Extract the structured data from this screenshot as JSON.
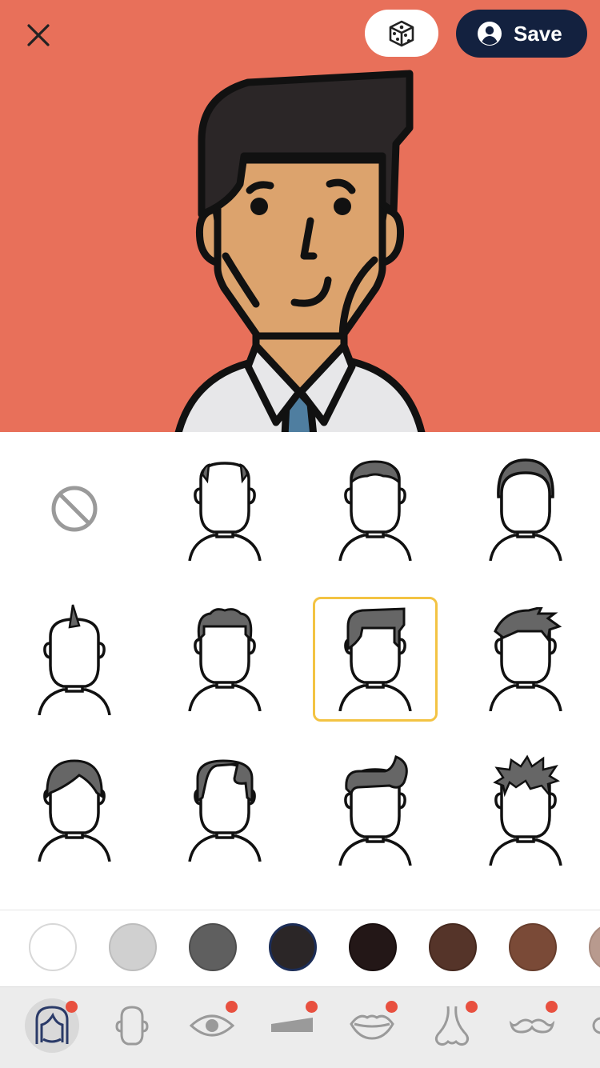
{
  "header": {
    "close_icon": "close-icon",
    "randomize_icon": "dice-icon",
    "save_label": "Save",
    "save_icon": "user-circle-icon"
  },
  "preview": {
    "background_color": "#e8705a",
    "hair_color": "#2b2627",
    "skin_color": "#dca36d",
    "shirt_color": "#e7e7e9",
    "tie_color": "#4f7ea0"
  },
  "hair_styles": {
    "selected_index": 6,
    "selection_color": "#f3c343",
    "items": [
      {
        "icon": "none-icon"
      },
      {
        "icon": "hair-bald-icon"
      },
      {
        "icon": "hair-buzz-icon"
      },
      {
        "icon": "hair-round-icon"
      },
      {
        "icon": "hair-mohawk-icon"
      },
      {
        "icon": "hair-curly-icon"
      },
      {
        "icon": "hair-side-part-icon"
      },
      {
        "icon": "hair-spiky-side-icon"
      },
      {
        "icon": "hair-bowl-icon"
      },
      {
        "icon": "hair-slick-icon"
      },
      {
        "icon": "hair-quiff-icon"
      },
      {
        "icon": "hair-messy-icon"
      }
    ]
  },
  "hair_colors": {
    "selected_index": 3,
    "swatches": [
      "#ffffff",
      "#d0d0d0",
      "#5f5f5f",
      "#2b2627",
      "#231717",
      "#553429",
      "#7a4a37",
      "#b89a8e"
    ]
  },
  "feature_tabs": {
    "active_index": 0,
    "items": [
      {
        "icon": "hair-tab-icon",
        "has_badge": true
      },
      {
        "icon": "face-shape-icon",
        "has_badge": false
      },
      {
        "icon": "eye-icon",
        "has_badge": true
      },
      {
        "icon": "eyebrow-icon",
        "has_badge": true
      },
      {
        "icon": "mouth-icon",
        "has_badge": true
      },
      {
        "icon": "nose-icon",
        "has_badge": true
      },
      {
        "icon": "mustache-icon",
        "has_badge": true
      },
      {
        "icon": "glasses-icon",
        "has_badge": false
      }
    ]
  }
}
